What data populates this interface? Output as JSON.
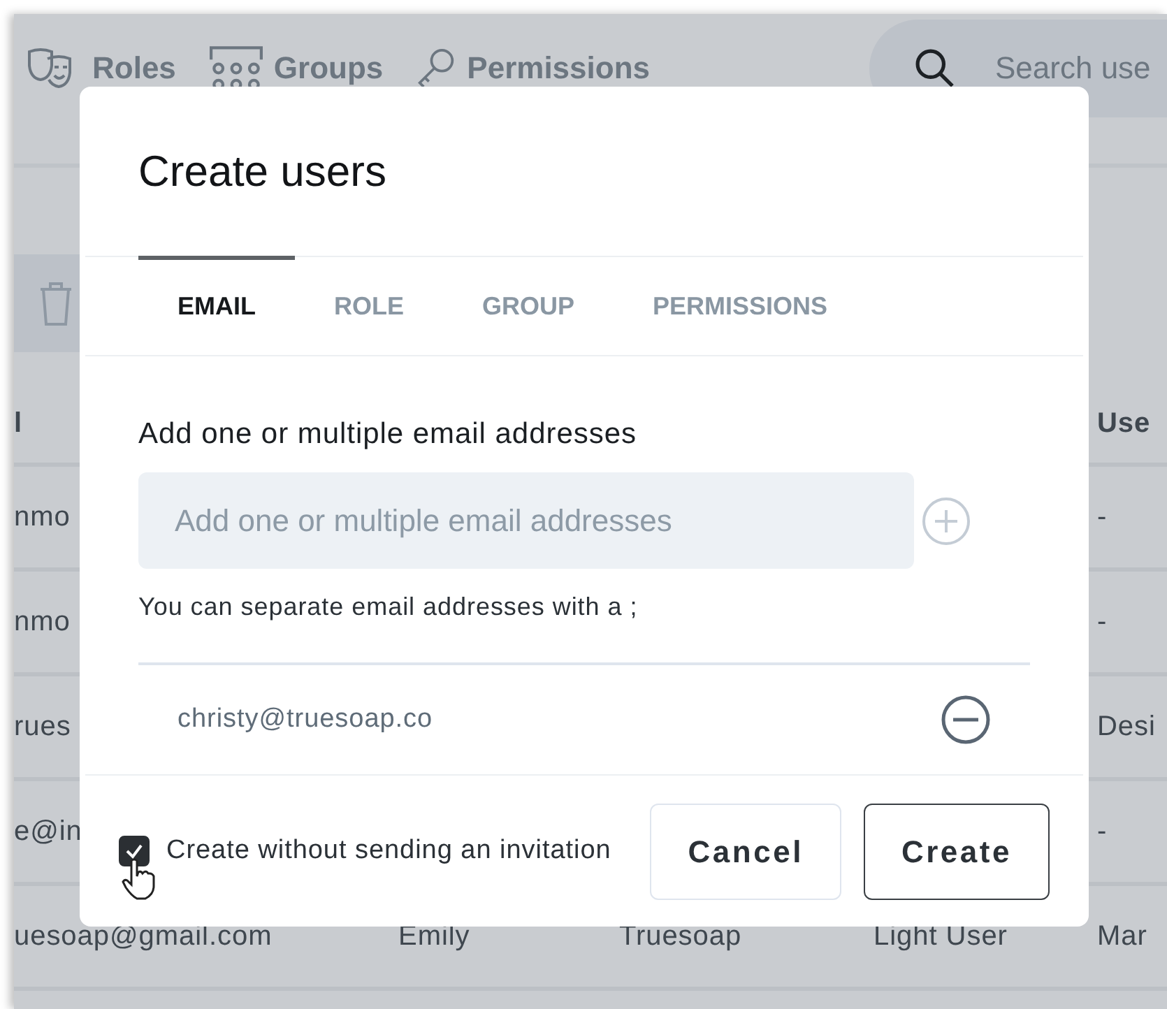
{
  "nav": [
    {
      "label": "Roles"
    },
    {
      "label": "Groups"
    },
    {
      "label": "Permissions"
    }
  ],
  "search": {
    "placeholder": "Search use"
  },
  "table": {
    "header_left": "l",
    "header_right": "Use",
    "rows": [
      {
        "cells": [
          "nmo",
          "-"
        ]
      },
      {
        "cells": [
          "nmo",
          "-"
        ]
      },
      {
        "cells": [
          "rues",
          "Desi"
        ]
      },
      {
        "cells": [
          "e@in",
          "-"
        ]
      },
      {
        "cells": [
          "uesoap@gmail.com",
          "Emily",
          "Truesoap",
          "Light User",
          "Mar"
        ]
      }
    ]
  },
  "dialog": {
    "title": "Create users",
    "tabs": [
      {
        "label": "EMAIL",
        "selected": true
      },
      {
        "label": "ROLE",
        "selected": false
      },
      {
        "label": "GROUP",
        "selected": false
      },
      {
        "label": "PERMISSIONS",
        "selected": false
      }
    ],
    "field_label": "Add one or multiple email addresses",
    "email_input": {
      "placeholder": "Add one or multiple email addresses"
    },
    "hint": "You can separate email addresses with a ;",
    "emails": [
      "christy@truesoap.co"
    ],
    "no_invite": {
      "label": "Create without sending an invitation",
      "checked": true
    },
    "buttons": [
      {
        "label": "Cancel",
        "kind": "secondary"
      },
      {
        "label": "Create",
        "kind": "primary"
      }
    ]
  }
}
